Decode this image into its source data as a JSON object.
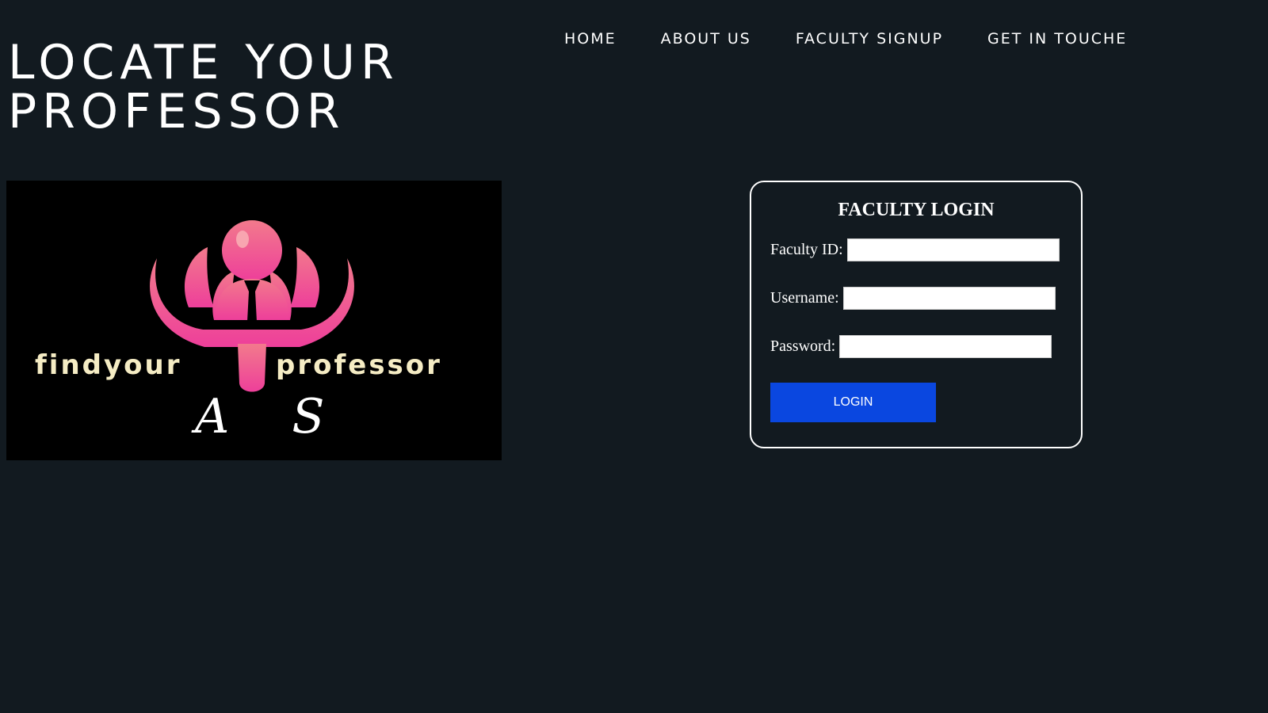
{
  "header": {
    "title": "LOCATE YOUR PROFESSOR"
  },
  "nav": {
    "items": [
      {
        "label": "HOME"
      },
      {
        "label": "ABOUT US"
      },
      {
        "label": "FACULTY SIGNUP"
      },
      {
        "label": "GET IN TOUCHE"
      }
    ]
  },
  "logo": {
    "wordmark_left": "findyour",
    "wordmark_right": "professor",
    "initials": "A S",
    "colors": {
      "background": "#000000",
      "icon_pink": "#f25a8a",
      "wordmark": "#f5ecc4"
    }
  },
  "login": {
    "title": "FACULTY LOGIN",
    "faculty_id_label": "Faculty ID:",
    "faculty_id_value": "",
    "username_label": "Username:",
    "username_value": "",
    "password_label": "Password:",
    "password_value": "",
    "button_label": "LOGIN"
  },
  "colors": {
    "page_background": "#121a20",
    "button": "#0a47e0",
    "text": "#ffffff"
  }
}
